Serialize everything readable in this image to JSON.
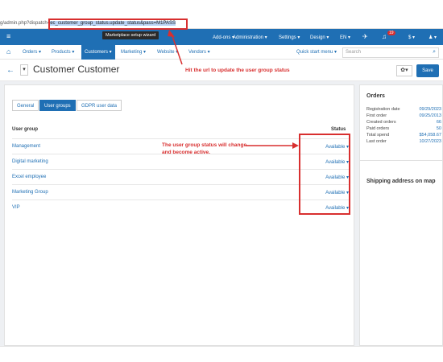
{
  "browser": {
    "url_prefix": "g/admin.php?dispatch=",
    "url_highlight": "ec_customer_group_status.update_status&pass=M1PASS"
  },
  "topnav": {
    "items": [
      "Add-ons ▾",
      "Administration ▾",
      "Settings ▾",
      "Design ▾",
      "EN ▾",
      "$ ▾",
      "♟ ▾"
    ],
    "notification_badge": "19",
    "tooltip": "Marketplace setup wizard"
  },
  "mainnav": {
    "items": [
      "Orders ▾",
      "Products ▾",
      "Customers ▾",
      "Marketing ▾",
      "Website ▾",
      "Vendors ▾"
    ],
    "active_index": 2,
    "quick_start": "Quick start menu ▾",
    "search_placeholder": "Search"
  },
  "page": {
    "title": "Customer Customer",
    "save": "Save"
  },
  "tabs": [
    "General",
    "User groups",
    "GDPR user data"
  ],
  "active_tab": 1,
  "table": {
    "headers": {
      "group": "User group",
      "status": "Status"
    },
    "rows": [
      {
        "name": "Management",
        "status": "Available ▾"
      },
      {
        "name": "Digital marketing",
        "status": "Available ▾"
      },
      {
        "name": "Excel employee",
        "status": "Available ▾"
      },
      {
        "name": "Marketing Group",
        "status": "Available ▾"
      },
      {
        "name": "VIP",
        "status": "Available ▾"
      }
    ]
  },
  "orders": {
    "title": "Orders",
    "rows": [
      {
        "label": "Registration date",
        "value": "09/29/2023"
      },
      {
        "label": "First order",
        "value": "09/25/2013"
      },
      {
        "label": "Created orders",
        "value": "66"
      },
      {
        "label": "Paid orders",
        "value": "50"
      },
      {
        "label": "Total spend",
        "value": "$54,058.67"
      },
      {
        "label": "Last order",
        "value": "10/27/2023"
      }
    ]
  },
  "shipping": {
    "title": "Shipping address on map"
  },
  "annotations": {
    "url_note": "Hit the url to update the user group status",
    "status_note_line1": "The user group status will change",
    "status_note_line2": "and become active."
  },
  "colors": {
    "accent": "#1f6fb4",
    "annotation": "#d82f2f"
  }
}
